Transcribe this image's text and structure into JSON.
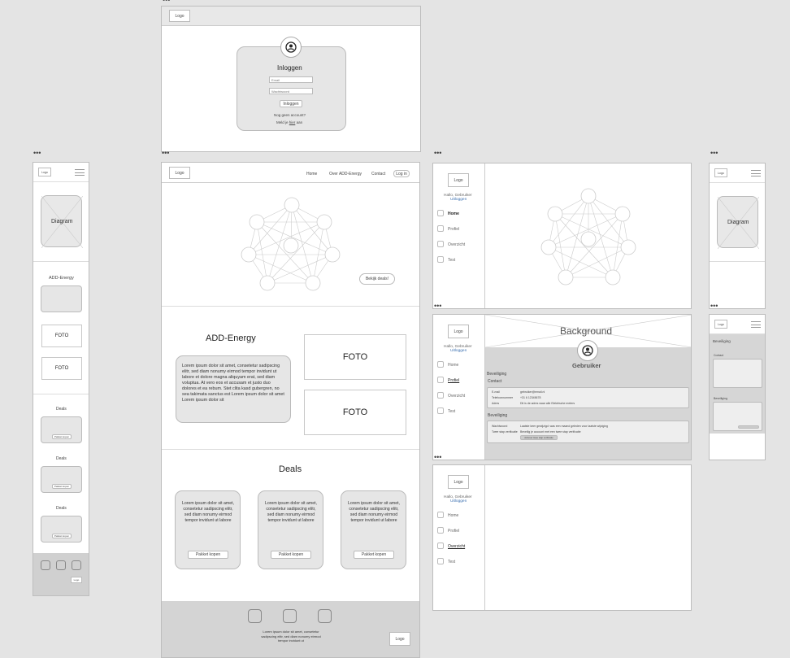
{
  "common": {
    "logo": "Logo",
    "lorem_short": "Lorem ipsum dolor sit amet, consetetur sadipscing elitr, sed diam nonumy eirmod tempor invidunt ut labore",
    "lorem_long": "Lorem ipsum dolor sit amet, consetetur sadipscing elitr, sed diam nonumy eirmod tempor invidunt ut labore et dolore magna aliquyam erat, sed diam voluptua. At vero eos et accusam et justo duo dolores et ea rebum. Stet clita kasd gubergren, no sea takimata sanctus est Lorem ipsum dolor sit amet Lorem ipsum dolor sit",
    "lorem_footer": "Lorem ipsum dolor sit amet, consetetur sadipscing elitr, sed diam nonumy eirmod tempor invidunt ut",
    "diagram": "Diagram",
    "foto": "FOTO"
  },
  "login": {
    "title": "Inloggen",
    "email_placeholder": "Email",
    "password_placeholder": "Wachtwoord",
    "button": "Inloggen",
    "no_account": "Nog geen account?",
    "register_prefix": "Meld je",
    "register_link": "hier",
    "register_suffix": "aan"
  },
  "nav": {
    "items": [
      "Home",
      "Over ADD-Energy",
      "Contact"
    ],
    "login_button": "Log in"
  },
  "home": {
    "cta": "Bekijk deals!",
    "about_title": "ADD-Energy",
    "deals_title": "Deals",
    "deal_button": "Pakket kopen"
  },
  "dashboard": {
    "greeting": "Hallo, Gebruiker",
    "logout": "Uitloggen",
    "menu": [
      "Home",
      "Profiel",
      "Overzicht",
      "Test"
    ],
    "background": "Background",
    "user_name": "Gebruiker",
    "section_beveiliging": "Beveiliging",
    "section_contact": "Contact",
    "contact_rows": [
      {
        "label": "E-mail",
        "value": "gebruiker@email.nl"
      },
      {
        "label": "Telefoonnummer",
        "value": "+31 6 12345678"
      },
      {
        "label": "Adres",
        "value": "Dit is de adres waar alle Elektrische meters"
      }
    ],
    "security_rows": [
      {
        "label": "Wachtwoord",
        "value": "Laatste keer gewijzigd: was een maand geleden voor laatste wijziging"
      },
      {
        "label": "Twee stap verificatie",
        "value": "Beveilig je account met een twee stap verificatie"
      }
    ],
    "twofa_button": "Activeer twee stap verificatie"
  }
}
